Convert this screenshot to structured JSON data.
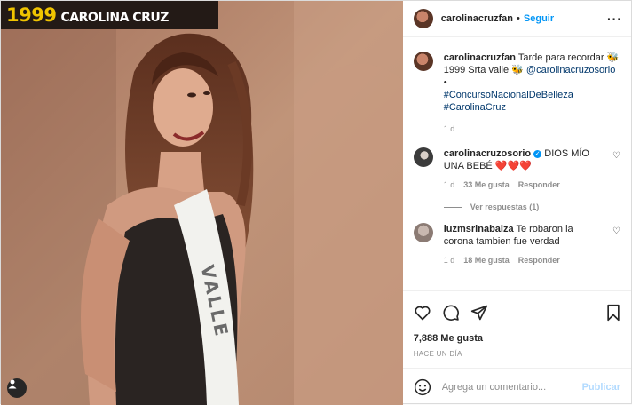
{
  "photo": {
    "year": "1999",
    "name": "CAROLINA CRUZ",
    "sash": "VALLE"
  },
  "header": {
    "username": "carolinacruzfan",
    "separator": "•",
    "follow_label": "Seguir",
    "more_label": "···"
  },
  "caption": {
    "username": "carolinacruzfan",
    "text": "Tarde para recordar 🐝 1999 Srta valle 🐝 ",
    "mention": "@carolinacruzosorio",
    "bullet": "•",
    "tag1": "#ConcursoNacionalDeBelleza",
    "tag2": "#CarolinaCruz",
    "time": "1 d"
  },
  "comments": [
    {
      "username": "carolinacruzosorio",
      "verified_mark": "✓",
      "text": "DIOS MÍO UNA BEBÉ",
      "hearts": "❤️❤️❤️",
      "time": "1 d",
      "likes": "33 Me gusta",
      "reply": "Responder",
      "view_replies": "Ver respuestas (1)"
    },
    {
      "username": "luzmsrinabalza",
      "text": "Te robaron la corona tambien fue verdad",
      "time": "1 d",
      "likes": "18 Me gusta",
      "reply": "Responder"
    }
  ],
  "stats": {
    "likes": "7,888 Me gusta",
    "ago": "HACE UN DÍA"
  },
  "composer": {
    "placeholder": "Agrega un comentario...",
    "publish_label": "Publicar"
  },
  "colors": {
    "accent": "#0095f6",
    "link": "#00376b",
    "muted": "#8e8e8e",
    "publish_disabled": "#b3dbff"
  }
}
